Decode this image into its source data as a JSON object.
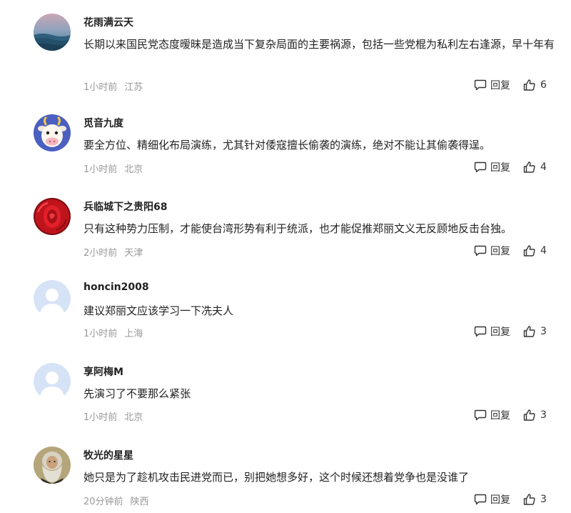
{
  "colors": {
    "text": "#222222",
    "meta": "#999999",
    "action": "#333333"
  },
  "comments": [
    {
      "username": "花雨满云天",
      "avatar_icon": "ocean-wave-avatar",
      "content": "长期以来国民党态度暧昧是造成当下复杂局面的主要祸源，包括一些党棍为私利左右逢源，早十年有",
      "time": "1小时前",
      "location": "江苏",
      "reply_label": "回复",
      "likes": "6"
    },
    {
      "username": "觅音九度",
      "avatar_icon": "cartoon-cow-avatar",
      "content": "要全方位、精细化布局演练，尤其针对倭寇擅长偷袭的演练，绝对不能让其偷袭得逞。",
      "time": "1小时前",
      "location": "北京",
      "reply_label": "回复",
      "likes": "4"
    },
    {
      "username": "兵临城下之贵阳68",
      "avatar_icon": "red-rose-avatar",
      "content": "只有这种势力压制，才能使台湾形势有利于统派，也才能促推郑丽文义无反顾地反击台独。",
      "time": "2小时前",
      "location": "天津",
      "reply_label": "回复",
      "likes": "4"
    },
    {
      "username": "honcin2008",
      "avatar_icon": "default-user-avatar",
      "content": "建议郑丽文应该学习一下冼夫人",
      "time": "1小时前",
      "location": "上海",
      "reply_label": "回复",
      "likes": "3"
    },
    {
      "username": "享阿梅M",
      "avatar_icon": "default-user-avatar",
      "content": "先演习了不要那么紧张",
      "time": "1小时前",
      "location": "北京",
      "reply_label": "回复",
      "likes": "3"
    },
    {
      "username": "牧光的星星",
      "avatar_icon": "bearded-man-portrait-avatar",
      "content": "她只是为了趁机攻击民进党而已，别把她想多好，这个时候还想着党争也是没谁了",
      "time": "20分钟前",
      "location": "陕西",
      "reply_label": "回复",
      "likes": "3"
    }
  ]
}
